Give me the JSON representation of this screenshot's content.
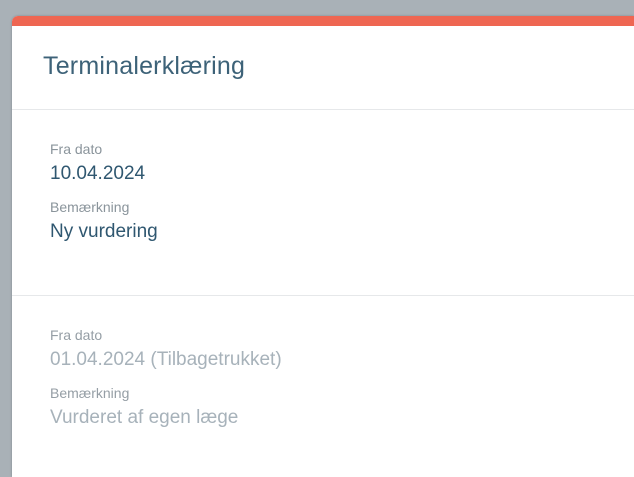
{
  "card": {
    "title": "Terminalerklæring",
    "accent_color": "#ee6652"
  },
  "entries": [
    {
      "from_label": "Fra dato",
      "from_value": "10.04.2024",
      "note_label": "Bemærkning",
      "note_value": "Ny vurdering",
      "status": "active"
    },
    {
      "from_label": "Fra dato",
      "from_value": "01.04.2024 (Tilbagetrukket)",
      "note_label": "Bemærkning",
      "note_value": "Vurderet af egen læge",
      "status": "withdrawn"
    }
  ]
}
